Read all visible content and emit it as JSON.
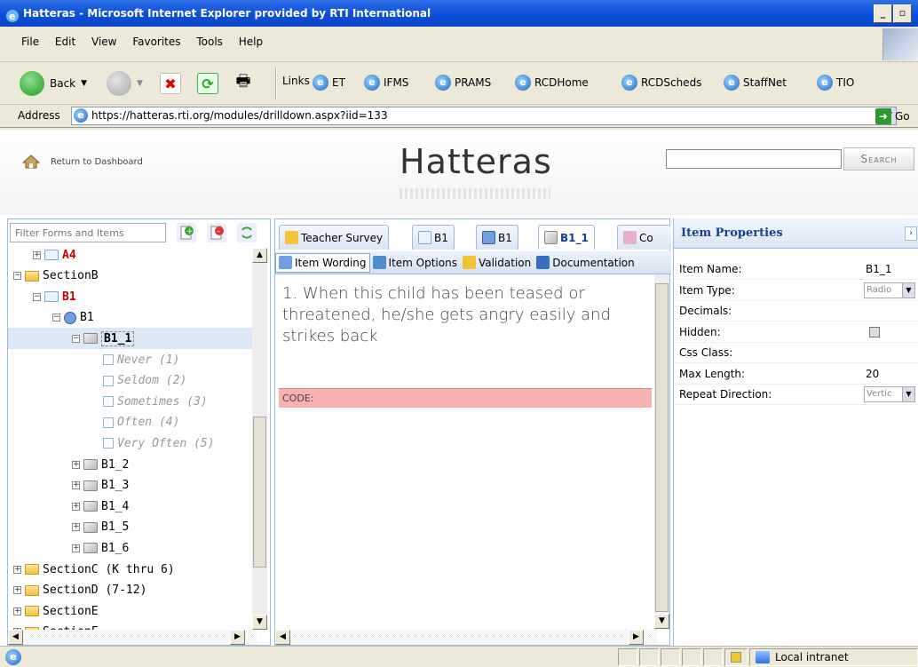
{
  "window": {
    "title": "Hatteras - Microsoft Internet Explorer provided by RTI International"
  },
  "menu": [
    "File",
    "Edit",
    "View",
    "Favorites",
    "Tools",
    "Help"
  ],
  "toolbar": {
    "back_label": "Back"
  },
  "links": {
    "label": "Links",
    "items": [
      "ET",
      "IFMS",
      "PRAMS",
      "RCDHome",
      "RCDScheds",
      "StaffNet",
      "TIO"
    ]
  },
  "address": {
    "label": "Address",
    "url": "https://hatteras.rti.org/modules/drilldown.aspx?iid=133",
    "go": "Go"
  },
  "header": {
    "return_label": "Return to Dashboard",
    "brand": "Hatteras",
    "search_button": "Search",
    "search_value": ""
  },
  "left": {
    "filter_placeholder": "Filter Forms and Items",
    "tree": [
      {
        "label": "A4",
        "indent": 1,
        "kind": "form",
        "red": true,
        "toggle": "+"
      },
      {
        "label": "SectionB",
        "indent": 0,
        "kind": "folder",
        "toggle": "-"
      },
      {
        "label": "B1",
        "indent": 1,
        "kind": "form",
        "red": true,
        "toggle": "-"
      },
      {
        "label": "B1",
        "indent": 2,
        "kind": "question",
        "toggle": "-"
      },
      {
        "label": "B1_1",
        "indent": 3,
        "kind": "cube",
        "bold": true,
        "selected": true,
        "toggle": "-"
      },
      {
        "label": "Never (1)",
        "indent": 4,
        "kind": "option",
        "grey": true
      },
      {
        "label": "Seldom (2)",
        "indent": 4,
        "kind": "option",
        "grey": true
      },
      {
        "label": "Sometimes (3)",
        "indent": 4,
        "kind": "option",
        "grey": true
      },
      {
        "label": "Often (4)",
        "indent": 4,
        "kind": "option",
        "grey": true
      },
      {
        "label": "Very Often (5)",
        "indent": 4,
        "kind": "option",
        "grey": true
      },
      {
        "label": "B1_2",
        "indent": 3,
        "kind": "cube",
        "toggle": "+"
      },
      {
        "label": "B1_3",
        "indent": 3,
        "kind": "cube",
        "toggle": "+"
      },
      {
        "label": "B1_4",
        "indent": 3,
        "kind": "cube",
        "toggle": "+"
      },
      {
        "label": "B1_5",
        "indent": 3,
        "kind": "cube",
        "toggle": "+"
      },
      {
        "label": "B1_6",
        "indent": 3,
        "kind": "cube",
        "toggle": "+"
      },
      {
        "label": "SectionC (K thru 6)",
        "indent": 0,
        "kind": "folder",
        "toggle": "+"
      },
      {
        "label": "SectionD (7-12)",
        "indent": 0,
        "kind": "folder",
        "toggle": "+"
      },
      {
        "label": "SectionE",
        "indent": 0,
        "kind": "folder",
        "toggle": "+"
      },
      {
        "label": "SectionF",
        "indent": 0,
        "kind": "folder",
        "toggle": "+"
      }
    ]
  },
  "tabs": [
    {
      "label": "Teacher Survey"
    },
    {
      "label": "B1"
    },
    {
      "label": "B1"
    },
    {
      "label": "B1_1",
      "active": true
    },
    {
      "label": "Co"
    }
  ],
  "subtabs": [
    {
      "label": "Item Wording",
      "active": true
    },
    {
      "label": "Item Options"
    },
    {
      "label": "Validation"
    },
    {
      "label": "Documentation"
    }
  ],
  "item": {
    "wording": "1. When this child has been teased or threatened, he/she gets angry easily and strikes back",
    "code_label": "CODE:"
  },
  "properties": {
    "title": "Item Properties",
    "rows": [
      {
        "name": "Item Name:",
        "value": "B1_1",
        "type": "text"
      },
      {
        "name": "Item Type:",
        "value": "Radio",
        "type": "combo"
      },
      {
        "name": "Decimals:",
        "value": "",
        "type": "text"
      },
      {
        "name": "Hidden:",
        "value": "",
        "type": "check"
      },
      {
        "name": "Css Class:",
        "value": "",
        "type": "text"
      },
      {
        "name": "Max Length:",
        "value": "20",
        "type": "text"
      },
      {
        "name": "Repeat Direction:",
        "value": "Vertic",
        "type": "combo"
      }
    ]
  },
  "status": {
    "zone": "Local intranet"
  }
}
